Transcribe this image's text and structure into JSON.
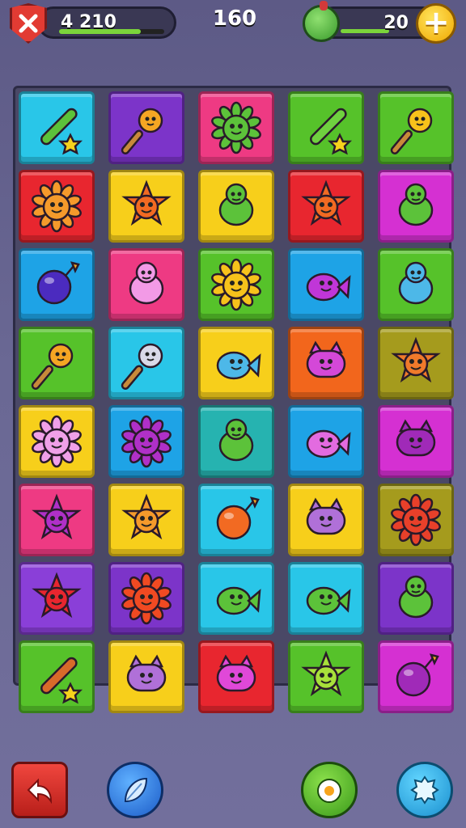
{
  "hud": {
    "score": "4 210",
    "score_progress": 0.78,
    "moves": "160",
    "gems": "20",
    "plus_label": "+"
  },
  "colors": {
    "cyan": "#29c6e8",
    "purple": "#7c34c9",
    "pink": "#ee3a83",
    "green": "#56c22a",
    "yellow": "#f7cf1b",
    "red": "#e8262f",
    "magenta": "#d530d2",
    "blue": "#1ea3e6",
    "orange": "#f2661c",
    "olive": "#a59b1d",
    "violet": "#8a3fd8",
    "teal": "#26b3b0"
  },
  "board": {
    "rows": [
      [
        {
          "color": "cyan",
          "icon": "leaf-sword-icon",
          "fg": "#5cc23a"
        },
        {
          "color": "purple",
          "icon": "star-wand-icon",
          "fg": "#f5a623"
        },
        {
          "color": "pink",
          "icon": "flower-monster-icon",
          "fg": "#5cc23a"
        },
        {
          "color": "green",
          "icon": "club-icon",
          "fg": "#6fd13f"
        },
        {
          "color": "green",
          "icon": "sun-wand-icon",
          "fg": "#f7c21b"
        }
      ],
      [
        {
          "color": "red",
          "icon": "sun-monster-icon",
          "fg": "#f59a2b"
        },
        {
          "color": "yellow",
          "icon": "star-monster-icon",
          "fg": "#f26a22"
        },
        {
          "color": "yellow",
          "icon": "cactus-monster-icon",
          "fg": "#5cc23a"
        },
        {
          "color": "red",
          "icon": "star-monster-icon",
          "fg": "#f26a22"
        },
        {
          "color": "magenta",
          "icon": "turtle-monster-icon",
          "fg": "#5cc23a"
        }
      ],
      [
        {
          "color": "blue",
          "icon": "bomb-icon",
          "fg": "#4b2bbf"
        },
        {
          "color": "pink",
          "icon": "octopus-monster-icon",
          "fg": "#f29ae6"
        },
        {
          "color": "green",
          "icon": "sun-monster-icon",
          "fg": "#f7c21b"
        },
        {
          "color": "blue",
          "icon": "fish-monster-icon",
          "fg": "#c036d8"
        },
        {
          "color": "green",
          "icon": "ghost-monster-icon",
          "fg": "#4db8e8"
        }
      ],
      [
        {
          "color": "green",
          "icon": "wand-pair-icon",
          "fg": "#f5a623"
        },
        {
          "color": "cyan",
          "icon": "hammer-icon",
          "fg": "#d9d9e8"
        },
        {
          "color": "yellow",
          "icon": "fish-monster-icon",
          "fg": "#4db8e8"
        },
        {
          "color": "orange",
          "icon": "cat-monster-icon",
          "fg": "#d448d8"
        },
        {
          "color": "olive",
          "icon": "star-monster-icon",
          "fg": "#f07a2b"
        }
      ],
      [
        {
          "color": "yellow",
          "icon": "flower-monster-icon",
          "fg": "#f0a0e8"
        },
        {
          "color": "blue",
          "icon": "flower-monster-icon",
          "fg": "#b030c8"
        },
        {
          "color": "teal",
          "icon": "snail-monster-icon",
          "fg": "#5cc23a"
        },
        {
          "color": "blue",
          "icon": "bubble-monster-icon",
          "fg": "#e36be0"
        },
        {
          "color": "magenta",
          "icon": "blob-monster-icon",
          "fg": "#a02ab8"
        }
      ],
      [
        {
          "color": "pink",
          "icon": "star-monster-icon",
          "fg": "#b030c8"
        },
        {
          "color": "yellow",
          "icon": "star-monster-icon",
          "fg": "#f59a2b"
        },
        {
          "color": "cyan",
          "icon": "bomb-icon",
          "fg": "#f26a22"
        },
        {
          "color": "yellow",
          "icon": "cat-monster-icon",
          "fg": "#b070d8"
        },
        {
          "color": "olive",
          "icon": "flame-monster-icon",
          "fg": "#e8402a"
        }
      ],
      [
        {
          "color": "violet",
          "icon": "star-monster-icon",
          "fg": "#e8262f"
        },
        {
          "color": "purple",
          "icon": "sun-monster-icon",
          "fg": "#f04a22"
        },
        {
          "color": "cyan",
          "icon": "fish-monster-icon",
          "fg": "#5cc23a"
        },
        {
          "color": "cyan",
          "icon": "fish-monster-icon",
          "fg": "#5cc23a"
        },
        {
          "color": "purple",
          "icon": "leaf-monster-icon",
          "fg": "#5cc23a"
        }
      ],
      [
        {
          "color": "green",
          "icon": "bat-icon",
          "fg": "#d86a2a"
        },
        {
          "color": "yellow",
          "icon": "cat-monster-icon",
          "fg": "#b070d8"
        },
        {
          "color": "red",
          "icon": "cat-monster-icon",
          "fg": "#e048d8"
        },
        {
          "color": "green",
          "icon": "star-monster-icon",
          "fg": "#a8e03a"
        },
        {
          "color": "magenta",
          "icon": "bomb-icon",
          "fg": "#a02ab8"
        }
      ]
    ]
  },
  "bottom_bar": {
    "back": "back-arrow-icon",
    "leaf": "leaf-icon",
    "egg": "egg-icon",
    "gem": "crystal-icon"
  }
}
